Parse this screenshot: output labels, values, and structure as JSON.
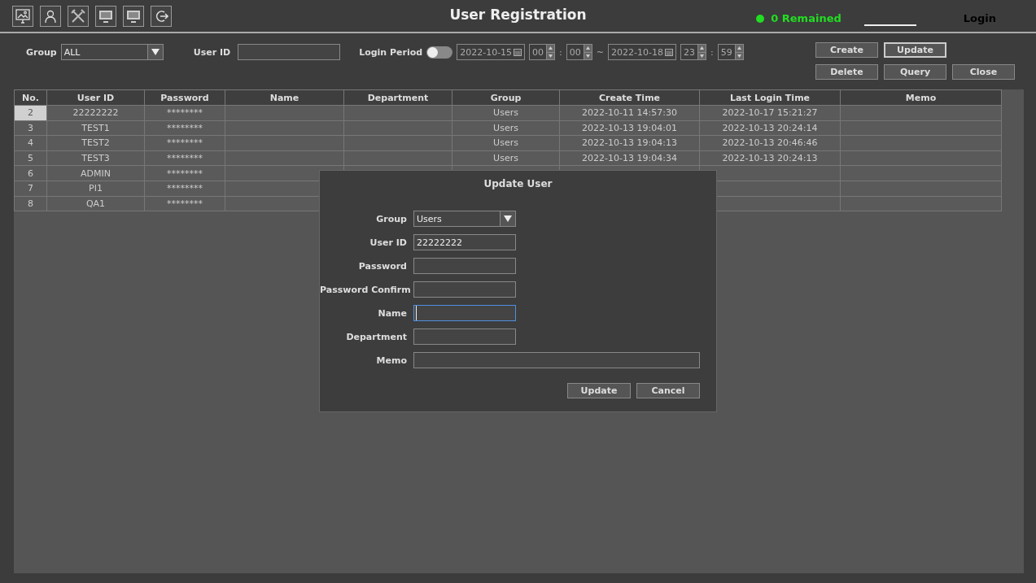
{
  "toolbar": {
    "icons": [
      {
        "kind": "monitor"
      },
      {
        "kind": "user"
      },
      {
        "kind": "tools"
      },
      {
        "kind": "display"
      },
      {
        "kind": "display"
      },
      {
        "kind": "logout"
      }
    ]
  },
  "title": "User Registration",
  "status": {
    "text": "0 Remained",
    "color": "#22dd22"
  },
  "login": "Login",
  "filter": {
    "group_label": "Group",
    "group_value": "ALL",
    "userid_label": "User ID",
    "period_label": "Login Period",
    "period_on": false,
    "from_date": "2022-10-15",
    "from_hour": "00",
    "from_min": "00",
    "separator": "~",
    "to_date": "2022-10-18",
    "to_hour": "23",
    "to_min": "59",
    "colon": ":"
  },
  "buttons": [
    [
      {
        "label": "Create",
        "selected": false
      },
      {
        "label": "Update",
        "selected": true
      }
    ],
    [
      {
        "label": "Delete",
        "selected": false
      },
      {
        "label": "Query",
        "selected": false
      },
      {
        "label": "Close",
        "selected": false
      }
    ]
  ],
  "table": {
    "columns": [
      "No.",
      "User ID",
      "Password",
      "Name",
      "Department",
      "Group",
      "Create Time",
      "Last Login Time",
      "Memo"
    ],
    "rows": [
      {
        "selected": true,
        "cells": [
          "2",
          "22222222",
          "********",
          "",
          "",
          "Users",
          "2022-10-11 14:57:30",
          "2022-10-17 15:21:27",
          ""
        ]
      },
      {
        "selected": false,
        "cells": [
          "3",
          "TEST1",
          "********",
          "",
          "",
          "Users",
          "2022-10-13 19:04:01",
          "2022-10-13 20:24:14",
          ""
        ]
      },
      {
        "selected": false,
        "cells": [
          "4",
          "TEST2",
          "********",
          "",
          "",
          "Users",
          "2022-10-13 19:04:13",
          "2022-10-13 20:46:46",
          ""
        ]
      },
      {
        "selected": false,
        "cells": [
          "5",
          "TEST3",
          "********",
          "",
          "",
          "Users",
          "2022-10-13 19:04:34",
          "2022-10-13 20:24:13",
          ""
        ]
      },
      {
        "selected": false,
        "cells": [
          "6",
          "ADMIN",
          "********"
        ]
      },
      {
        "selected": false,
        "cells": [
          "7",
          "PI1",
          "********"
        ]
      },
      {
        "selected": false,
        "cells": [
          "8",
          "QA1",
          "********"
        ]
      }
    ]
  },
  "dialog": {
    "title": "Update User",
    "fields": [
      {
        "kind": "select",
        "label": "Group",
        "value": "Users",
        "focused": false
      },
      {
        "kind": "text",
        "label": "User ID",
        "value": "22222222",
        "focused": false
      },
      {
        "kind": "text",
        "label": "Password",
        "focused": false
      },
      {
        "kind": "text",
        "label": "Password Confirm",
        "focused": false
      },
      {
        "kind": "text",
        "label": "Name",
        "focused": true
      },
      {
        "kind": "text",
        "label": "Department",
        "focused": false
      },
      {
        "kind": "wide",
        "label": "Memo",
        "focused": false
      }
    ],
    "buttons": [
      "Update",
      "Cancel"
    ]
  }
}
